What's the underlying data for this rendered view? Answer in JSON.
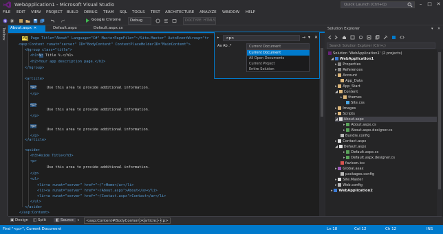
{
  "window": {
    "title": "WebApplication1 - Microsoft Visual Studio",
    "quick_launch_placeholder": "Quick Launch (Ctrl+Q)",
    "minimize": "–",
    "maximize": "□",
    "close": "✕"
  },
  "menu": [
    "FILE",
    "EDIT",
    "VIEW",
    "PROJECT",
    "BUILD",
    "DEBUG",
    "TEAM",
    "SQL",
    "TOOLS",
    "TEST",
    "ARCHITECTURE",
    "ANALYZE",
    "WINDOW",
    "HELP"
  ],
  "toolbar": {
    "run_label": "Google Chrome",
    "config": "Debug",
    "doctype": "DOCTYPE: HTML5"
  },
  "toolbox": {
    "label": "Toolbox"
  },
  "tabs": {
    "active": "About.aspx",
    "second": "Default.aspx",
    "third": "Default.aspx.cs"
  },
  "code": {
    "line0": "Page Title=\"About\" Language=\"C#\" MasterPageFile=\"~/Site.Master\" AutoEventWireup=\"tr",
    "line1": "<asp:Content runat=\"server\" ID=\"BodyContent\" ContentPlaceHolderID=\"MainContent\">",
    "line2": "<hgroup class=\"title\">",
    "line3_pre": "<h1>",
    "line3_tag": "%:",
    "line3_post": " Title %.</h1>",
    "line4": "<h2>Your app description page.</h2>",
    "line5": "</hgroup>",
    "line6": "<article>",
    "line7": "<p>",
    "line8": "Use this area to provide additional information.",
    "line9": "</p>",
    "line10": "<p>",
    "line11": "Use this area to provide additional information.",
    "line12": "</p>",
    "line13": "<p>",
    "line14": "Use this area to provide additional information.",
    "line15": "</p>",
    "line16": "</article>",
    "line17": "<aside>",
    "line18": "<h3>Aside Title</h3>",
    "line19": "<p>",
    "line20": "Use this area to provide additional information.",
    "line21": "</p>",
    "line22": "<ul>",
    "line23": "<li><a runat=\"server\" href=\"~/\">Home</a></li>",
    "line24": "<li><a runat=\"server\" href=\"~/About.aspx\">About</a></li>",
    "line25": "<li><a runat=\"server\" href=\"~/Contact.aspx\">Contact</a></li>",
    "line26": "</ul>",
    "line27": "</aside>",
    "line28": "</asp:Content>"
  },
  "find": {
    "query": "<p>",
    "options": "Aa  Ab  .*",
    "scope_current": "Current Document",
    "scope_options": [
      "Current Document",
      "All Open Documents",
      "Current Project",
      "Entire Solution"
    ],
    "selected_scope": "Current Document"
  },
  "solution_explorer": {
    "title": "Solution Explorer",
    "search_placeholder": "Search Solution Explorer (Ctrl+;)",
    "items": [
      "Solution 'WebApplication1' (2 projects)",
      "WebApplication1",
      "Properties",
      "References",
      "Account",
      "App_Data",
      "App_Start",
      "Content",
      "themes",
      "Site.css",
      "Images",
      "Scripts",
      "About.aspx",
      "About.aspx.cs",
      "About.aspx.designer.cs",
      "Bundle.config",
      "Contact.aspx",
      "Default.aspx",
      "Default.aspx.cs",
      "Default.aspx.designer.cs",
      "favicon.ico",
      "Global.asax",
      "packages.config",
      "Site.Master",
      "Web.config",
      "WebApplication2"
    ]
  },
  "bottom": {
    "design": "Design",
    "split": "Split",
    "source": "Source",
    "crumbs": [
      "<asp:Content#BodyContent>",
      "<article>",
      "<p>"
    ]
  },
  "status": {
    "message": "Find \"<p>\", Current Document",
    "ln": "Ln 18",
    "col": "Col 12",
    "ch": "Ch 12",
    "mode": "INS"
  },
  "colors": {
    "accent": "#007acc",
    "editor_bg": "#1e1e1e",
    "chrome_bg": "#2d2d30"
  }
}
